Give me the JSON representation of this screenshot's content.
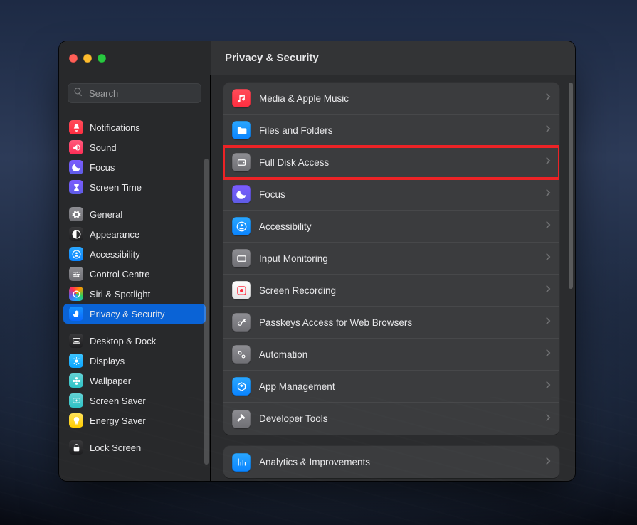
{
  "header": {
    "title": "Privacy & Security"
  },
  "search": {
    "placeholder": "Search",
    "value": ""
  },
  "sidebar": {
    "groups": [
      {
        "items": [
          {
            "id": "notifications",
            "label": "Notifications",
            "icon": "bell",
            "bg": "bg-red"
          },
          {
            "id": "sound",
            "label": "Sound",
            "icon": "speaker",
            "bg": "bg-pink"
          },
          {
            "id": "focus",
            "label": "Focus",
            "icon": "moon",
            "bg": "bg-purple"
          },
          {
            "id": "screentime",
            "label": "Screen Time",
            "icon": "hourglass",
            "bg": "bg-purple"
          }
        ]
      },
      {
        "items": [
          {
            "id": "general",
            "label": "General",
            "icon": "gear",
            "bg": "bg-grey"
          },
          {
            "id": "appearance",
            "label": "Appearance",
            "icon": "contrast",
            "bg": "bg-black"
          },
          {
            "id": "accessibility",
            "label": "Accessibility",
            "icon": "person",
            "bg": "bg-blue"
          },
          {
            "id": "controlcentre",
            "label": "Control Centre",
            "icon": "sliders",
            "bg": "bg-grey"
          },
          {
            "id": "siri",
            "label": "Siri & Spotlight",
            "icon": "siri",
            "bg": "bg-siri"
          },
          {
            "id": "privacy",
            "label": "Privacy & Security",
            "icon": "hand",
            "bg": "bg-hand",
            "selected": true
          }
        ]
      },
      {
        "items": [
          {
            "id": "desktopdock",
            "label": "Desktop & Dock",
            "icon": "dock",
            "bg": "bg-black"
          },
          {
            "id": "displays",
            "label": "Displays",
            "icon": "sun",
            "bg": "bg-cyan"
          },
          {
            "id": "wallpaper",
            "label": "Wallpaper",
            "icon": "flower",
            "bg": "bg-teal"
          },
          {
            "id": "screensaver",
            "label": "Screen Saver",
            "icon": "sparkle",
            "bg": "bg-teal"
          },
          {
            "id": "energy",
            "label": "Energy Saver",
            "icon": "bulb",
            "bg": "bg-yellow"
          }
        ]
      },
      {
        "items": [
          {
            "id": "lockscreen",
            "label": "Lock Screen",
            "icon": "lock",
            "bg": "bg-black"
          }
        ]
      }
    ]
  },
  "content": {
    "groups": [
      {
        "rows": [
          {
            "id": "media",
            "label": "Media & Apple Music",
            "icon": "music",
            "bg": "bg-red"
          },
          {
            "id": "files",
            "label": "Files and Folders",
            "icon": "folder",
            "bg": "bg-blue"
          },
          {
            "id": "fulldisk",
            "label": "Full Disk Access",
            "icon": "disk",
            "bg": "bg-grey",
            "highlight": true
          },
          {
            "id": "focus",
            "label": "Focus",
            "icon": "moon",
            "bg": "bg-purple"
          },
          {
            "id": "a11y",
            "label": "Accessibility",
            "icon": "person",
            "bg": "bg-blue"
          },
          {
            "id": "inputmon",
            "label": "Input Monitoring",
            "icon": "keyboard",
            "bg": "bg-grey"
          },
          {
            "id": "screenrec",
            "label": "Screen Recording",
            "icon": "record",
            "bg": "bg-white"
          },
          {
            "id": "passkeys",
            "label": "Passkeys Access for Web Browsers",
            "icon": "key",
            "bg": "bg-grey"
          },
          {
            "id": "automation",
            "label": "Automation",
            "icon": "gears",
            "bg": "bg-grey"
          },
          {
            "id": "appmgmt",
            "label": "App Management",
            "icon": "app",
            "bg": "bg-blue"
          },
          {
            "id": "devtools",
            "label": "Developer Tools",
            "icon": "hammer",
            "bg": "bg-grey"
          }
        ]
      },
      {
        "rows": [
          {
            "id": "analytics",
            "label": "Analytics & Improvements",
            "icon": "chart",
            "bg": "bg-blue"
          }
        ]
      }
    ]
  }
}
